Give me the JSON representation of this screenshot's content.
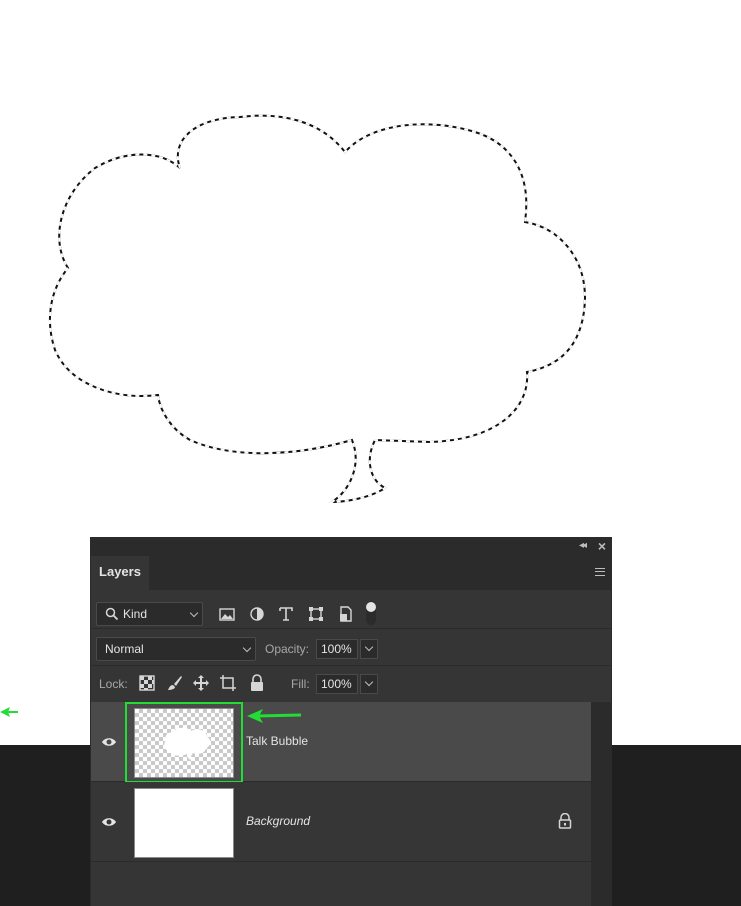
{
  "canvas": {
    "background": "#ffffff",
    "selection_color": "#000000"
  },
  "panel": {
    "tab_title": "Layers",
    "filter": {
      "kind_label": "Kind",
      "filter_icons": [
        "image-filter-icon",
        "adjustment-filter-icon",
        "type-filter-icon",
        "shape-filter-icon",
        "smart-object-filter-icon",
        "filter-toggle-icon"
      ]
    },
    "blend_mode": "Normal",
    "opacity_label": "Opacity:",
    "opacity_value": "100%",
    "lock_label": "Lock:",
    "lock_icons": [
      "lock-transparent-pixels-icon",
      "lock-image-pixels-icon",
      "lock-position-icon",
      "lock-artboard-icon",
      "lock-all-icon"
    ],
    "fill_label": "Fill:",
    "fill_value": "100%"
  },
  "layers": [
    {
      "name": "Talk Bubble",
      "visible": true,
      "selected": true,
      "highlighted": true,
      "thumbnail": "transparent-with-bubble"
    },
    {
      "name": "Background",
      "visible": true,
      "selected": false,
      "locked": true,
      "thumbnail": "white"
    }
  ],
  "colors": {
    "highlight": "#22dd33",
    "panel_bg": "#353535",
    "selected_row": "#4a4a4a",
    "text": "#e4e4e4"
  }
}
